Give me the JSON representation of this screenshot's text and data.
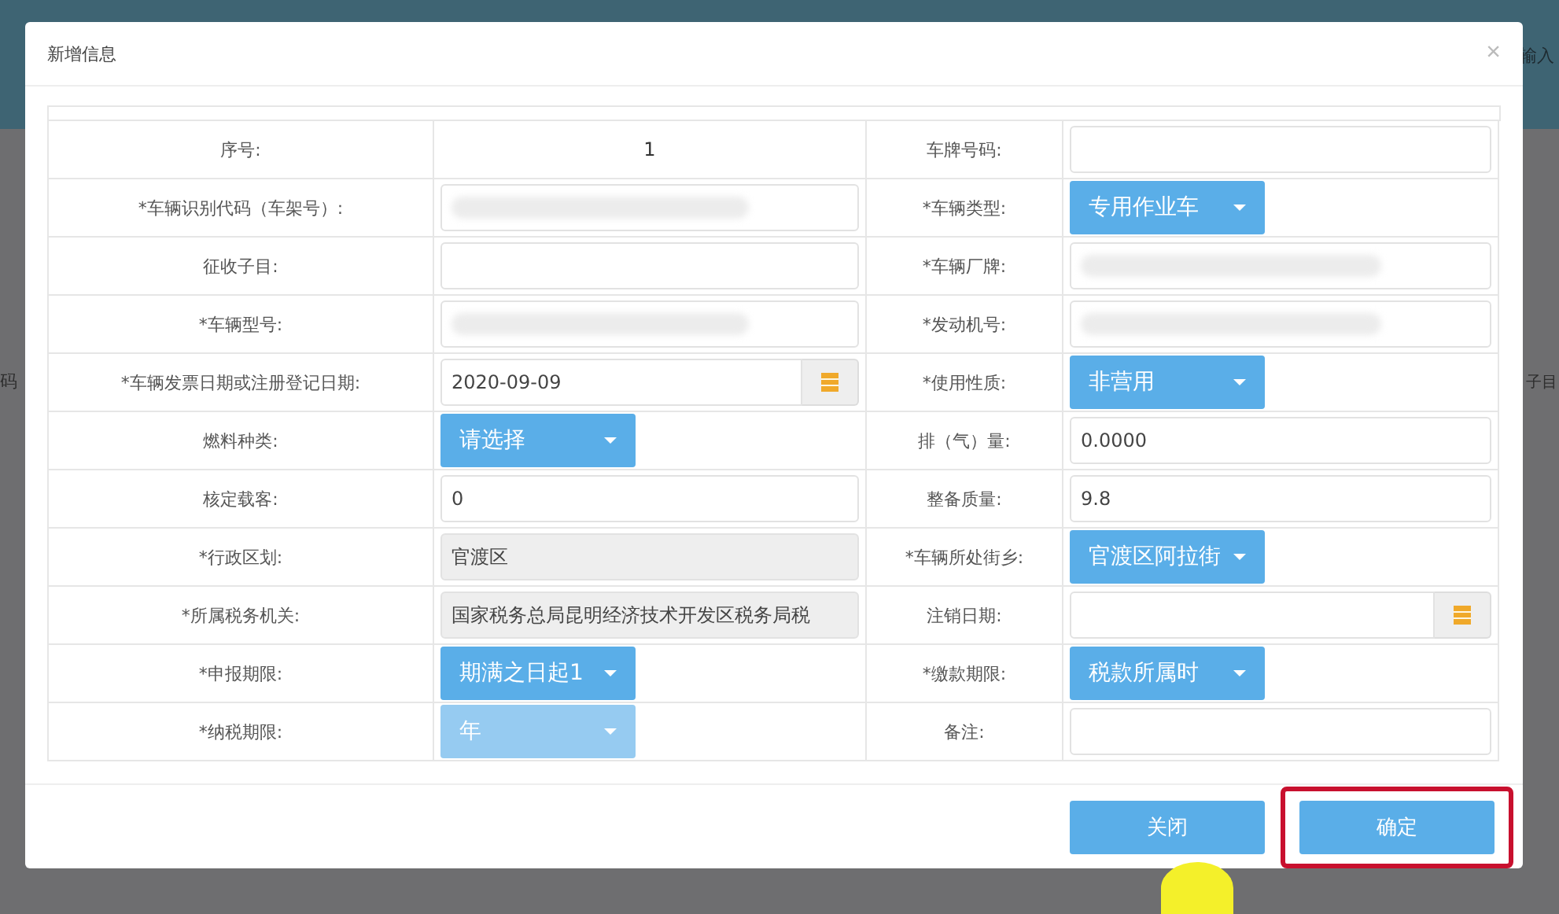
{
  "background": {
    "texts": [
      "输入",
      "码",
      "子目"
    ]
  },
  "dialog": {
    "title": "新增信息",
    "close": "×",
    "rows": [
      {
        "left": {
          "label": "序号:",
          "field": {
            "kind": "text",
            "value": "1"
          }
        },
        "right": {
          "label": "车牌号码:",
          "field": {
            "kind": "input",
            "disabled": false
          }
        }
      },
      {
        "left": {
          "label": "*车辆识别代码（车架号）:",
          "field": {
            "kind": "input",
            "disabled": false,
            "redacted": true
          }
        },
        "right": {
          "label": "*车辆类型:",
          "field": {
            "kind": "select",
            "value": "专用作业车",
            "disabled": false
          }
        }
      },
      {
        "left": {
          "label": "征收子目:",
          "field": {
            "kind": "input",
            "disabled": false
          }
        },
        "right": {
          "label": "*车辆厂牌:",
          "field": {
            "kind": "input",
            "disabled": false,
            "redacted": true
          }
        }
      },
      {
        "left": {
          "label": "*车辆型号:",
          "field": {
            "kind": "input",
            "disabled": false,
            "redacted": true
          }
        },
        "right": {
          "label": "*发动机号:",
          "field": {
            "kind": "input",
            "disabled": false,
            "redacted": true
          }
        }
      },
      {
        "left": {
          "label": "*车辆发票日期或注册登记日期:",
          "field": {
            "kind": "date",
            "value": "2020-09-09",
            "disabled": false
          }
        },
        "right": {
          "label": "*使用性质:",
          "field": {
            "kind": "select",
            "value": "非营用",
            "disabled": false
          }
        }
      },
      {
        "left": {
          "label": "燃料种类:",
          "field": {
            "kind": "select",
            "value": "请选择",
            "disabled": false
          }
        },
        "right": {
          "label": "排（气）量:",
          "field": {
            "kind": "input",
            "value": "0.0000",
            "disabled": false
          }
        }
      },
      {
        "left": {
          "label": "核定载客:",
          "field": {
            "kind": "input",
            "value": "0",
            "disabled": false
          }
        },
        "right": {
          "label": "整备质量:",
          "field": {
            "kind": "input",
            "value": "9.8",
            "disabled": false
          }
        }
      },
      {
        "left": {
          "label": "*行政区划:",
          "field": {
            "kind": "input",
            "value": "官渡区",
            "disabled": true
          }
        },
        "right": {
          "label": "*车辆所处街乡:",
          "field": {
            "kind": "select",
            "value": "官渡区阿拉街",
            "disabled": false
          }
        }
      },
      {
        "left": {
          "label": "*所属税务机关:",
          "field": {
            "kind": "input",
            "value": "国家税务总局昆明经济技术开发区税务局税",
            "disabled": true
          }
        },
        "right": {
          "label": "注销日期:",
          "field": {
            "kind": "date",
            "disabled": false
          }
        }
      },
      {
        "left": {
          "label": "*申报期限:",
          "field": {
            "kind": "select",
            "value": "期满之日起1",
            "disabled": false
          }
        },
        "right": {
          "label": "*缴款期限:",
          "field": {
            "kind": "select",
            "value": "税款所属时",
            "disabled": false
          }
        }
      },
      {
        "left": {
          "label": "*纳税期限:",
          "field": {
            "kind": "select",
            "value": "年",
            "disabled": true
          }
        },
        "right": {
          "label": "备注:",
          "field": {
            "kind": "input",
            "disabled": false
          }
        }
      }
    ],
    "buttons": [
      {
        "label": "关闭",
        "highlighted": false
      },
      {
        "label": "确定",
        "highlighted": true
      }
    ]
  }
}
